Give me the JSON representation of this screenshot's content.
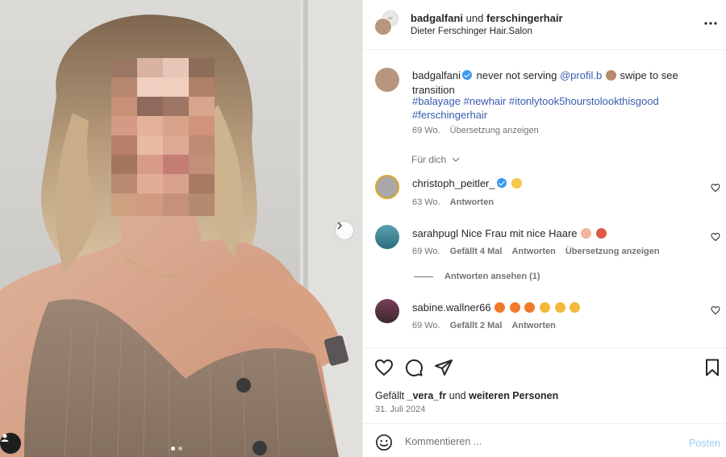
{
  "post": {
    "author": "badgalfani",
    "collab_connector": "und",
    "collaborator": "ferschingerhair",
    "location": "Dieter Ferschinger Hair.Salon",
    "carousel_total": 2,
    "carousel_index": 1
  },
  "caption": {
    "username": "badgalfani",
    "text_before_mention": "never not serving",
    "mention": "@profil.b",
    "text_after_mention": "swipe to see transition",
    "hashtags_line1": "#balayage #newhair #itonlytook5hourstolookthisgood",
    "hashtags_line2": "#ferschingerhair",
    "time": "69 Wo.",
    "translate": "Übersetzung anzeigen"
  },
  "for_you_label": "Für dich",
  "comments": [
    {
      "username": "christoph_peitler_",
      "text": "",
      "time": "63 Wo.",
      "reply": "Antworten"
    },
    {
      "username": "sarahpugl",
      "text": "Nice Frau mit nice Haare",
      "time": "69 Wo.",
      "likes": "Gefällt 4 Mal",
      "reply": "Antworten",
      "translate": "Übersetzung anzeigen",
      "view_replies": "Antworten ansehen (1)"
    },
    {
      "username": "sabine.wallner66",
      "text": "",
      "time": "69 Wo.",
      "likes": "Gefällt 2 Mal",
      "reply": "Antworten"
    }
  ],
  "liked_by": {
    "prefix": "Gefällt",
    "user": "_vera_fr",
    "middle": "und",
    "rest": "weiteren Personen"
  },
  "post_date": "31. Juli 2024",
  "composer": {
    "placeholder": "Kommentieren ...",
    "post_label": "Posten"
  },
  "icons": {
    "more": "more-horizontal-icon",
    "like": "heart-icon",
    "comment": "comment-icon",
    "share": "paper-plane-icon",
    "save": "bookmark-icon",
    "emoji": "smile-icon",
    "next": "chevron-right-icon",
    "tag": "user-tag-icon",
    "verified": "verified-badge-icon"
  },
  "colors": {
    "link": "#385bb0",
    "verified": "#3897f0",
    "post_button": "#9ccbf5",
    "secondary_text": "#737373"
  }
}
